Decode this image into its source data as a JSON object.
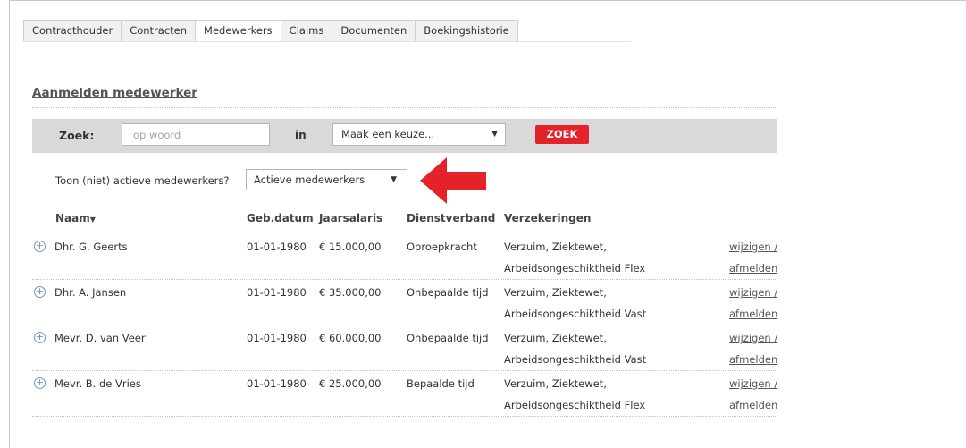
{
  "tabs": [
    "Contracthouder",
    "Contracten",
    "Medewerkers",
    "Claims",
    "Documenten",
    "Boekingshistorie"
  ],
  "active_tab": "Medewerkers",
  "section_title": "Aanmelden medewerker",
  "search": {
    "label": "Zoek:",
    "placeholder": "op woord",
    "in_label": "in",
    "select_value": "Maak een keuze...",
    "button_label": "ZOEK"
  },
  "filter": {
    "label": "Toon (niet) actieve medewerkers?",
    "value": "Actieve medewerkers"
  },
  "columns": {
    "naam": "Naam",
    "gebdatum": "Geb.datum",
    "jaarsalaris": "Jaarsalaris",
    "dienstverband": "Dienstverband",
    "verzekeringen": "Verzekeringen"
  },
  "rows": [
    {
      "naam": "Dhr. G. Geerts",
      "gebdatum": "01-01-1980",
      "jaarsalaris": "€ 15.000,00",
      "dienstverband": "Oproepkracht",
      "verzekeringen1": "Verzuim, Ziektewet,",
      "verzekeringen2": "Arbeidsongeschiktheid Flex",
      "wijzigen": "wijzigen /",
      "afmelden": "afmelden"
    },
    {
      "naam": "Dhr. A. Jansen",
      "gebdatum": "01-01-1980",
      "jaarsalaris": "€ 35.000,00",
      "dienstverband": "Onbepaalde tijd",
      "verzekeringen1": "Verzuim, Ziektewet,",
      "verzekeringen2": "Arbeidsongeschiktheid Vast",
      "wijzigen": "wijzigen /",
      "afmelden": "afmelden"
    },
    {
      "naam": "Mevr. D. van Veer",
      "gebdatum": "01-01-1980",
      "jaarsalaris": "€ 60.000,00",
      "dienstverband": "Onbepaalde tijd",
      "verzekeringen1": "Verzuim, Ziektewet,",
      "verzekeringen2": "Arbeidsongeschiktheid Vast",
      "wijzigen": "wijzigen /",
      "afmelden": "afmelden"
    },
    {
      "naam": "Mevr. B. de Vries",
      "gebdatum": "01-01-1980",
      "jaarsalaris": "€ 25.000,00",
      "dienstverband": "Bepaalde tijd",
      "verzekeringen1": "Verzuim, Ziektewet,",
      "verzekeringen2": "Arbeidsongeschiktheid Flex",
      "wijzigen": "wijzigen /",
      "afmelden": "afmelden"
    }
  ],
  "icons": {
    "expand": "plus-circle-icon",
    "sort": "sort-down-icon",
    "dropdown": "caret-down-icon",
    "annotation": "red-arrow-icon"
  },
  "colors": {
    "accent_red": "#e52129",
    "link_blue": "#6f95c4",
    "searchbar_bg": "#d9d9d9"
  }
}
